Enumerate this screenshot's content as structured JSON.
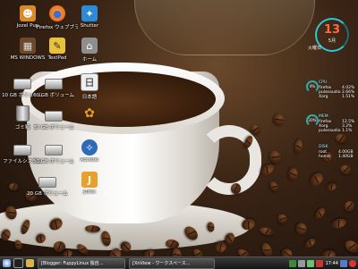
{
  "desktop": {
    "icons": [
      {
        "id": "puppy",
        "label": "Jozel Pup",
        "icon": "puppy-icon",
        "color": "#d98a2b",
        "glyph": "☻"
      },
      {
        "id": "firefox",
        "label": "Firefox ウェブブラウザ",
        "icon": "firefox-icon",
        "color": "#e66a1d",
        "glyph": "●"
      },
      {
        "id": "shutter",
        "label": "Shutter",
        "icon": "shutter-icon",
        "color": "#2d8ad6",
        "glyph": "✦"
      },
      {
        "id": "windows",
        "label": "MS WINDOWS",
        "icon": "windows-icon",
        "color": "#7a5a3a",
        "glyph": "▦"
      },
      {
        "id": "textpad",
        "label": "TextPad",
        "icon": "textpad-icon",
        "color": "#e7c23a",
        "glyph": "✎"
      },
      {
        "id": "home",
        "label": "ホーム",
        "icon": "home-folder-icon",
        "color": "#9b9b9b",
        "glyph": "⌂"
      },
      {
        "id": "drive1",
        "label": "10 GB ボリューム",
        "icon": "drive-icon",
        "color": "#cccccc",
        "glyph": ""
      },
      {
        "id": "drive2",
        "label": "60 GB ボリューム",
        "icon": "drive-icon",
        "color": "#cccccc",
        "glyph": ""
      },
      {
        "id": "japanese",
        "label": "日本語",
        "icon": "japanese-input-icon",
        "color": "#eeeeee",
        "glyph": "日"
      },
      {
        "id": "trash",
        "label": "ゴミ箱",
        "icon": "trash-icon",
        "color": "#aaaaaa",
        "glyph": ""
      },
      {
        "id": "drive3",
        "label": "80 GB ボリューム",
        "icon": "drive-icon",
        "color": "#cccccc",
        "glyph": ""
      },
      {
        "id": "gnome",
        "label": "",
        "icon": "app-icon",
        "color": "#d88a2a",
        "glyph": "✿"
      },
      {
        "id": "filesystem",
        "label": "ファイルシステム",
        "icon": "drive-icon",
        "color": "#cccccc",
        "glyph": ""
      },
      {
        "id": "drive4",
        "label": "50 GB ボリューム",
        "icon": "drive-icon",
        "color": "#cccccc",
        "glyph": ""
      },
      {
        "id": "xonotic",
        "label": "Xonotic",
        "icon": "game-icon",
        "color": "#4a8ad8",
        "glyph": "✧"
      },
      {
        "id": "drive5",
        "label": "20 GB ボリューム",
        "icon": "drive-icon",
        "color": "#cccccc",
        "glyph": ""
      },
      {
        "id": "jtrim",
        "label": "JTrim",
        "icon": "jtrim-icon",
        "color": "#e8a02a",
        "glyph": "J"
      }
    ]
  },
  "conky": {
    "day": "13",
    "month": "5月",
    "weekday": "火曜日",
    "cpu_title": "CPU",
    "cpu_rows": [
      "firefox",
      "pulseaudio",
      "Xorg"
    ],
    "cpu_vals": [
      "4.02%",
      "2.66%",
      "1.51%"
    ],
    "cpu_gauge": "4%",
    "mem_title": "MEM",
    "mem_rows": [
      "firefox",
      "Xorg",
      "pulseaudio"
    ],
    "mem_vals": [
      "12.5%",
      "3.2%",
      "1.1%"
    ],
    "mem_gauge": "20%",
    "disk_title": "DISK",
    "disk_rows": [
      "root",
      "home"
    ],
    "disk_vals": [
      "4.00GB",
      "1.40GB"
    ]
  },
  "taskbar": {
    "tasks": [
      "[Blogger: FuppyLinux 独自...",
      "[XnView - ワークスペース..."
    ],
    "clock": "17:44"
  }
}
